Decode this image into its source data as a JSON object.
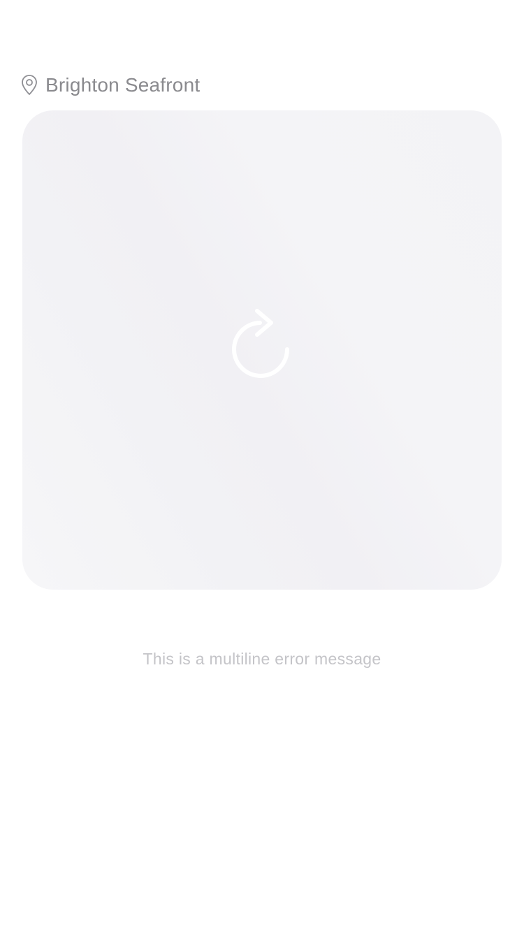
{
  "location": {
    "icon": "map-pin-icon",
    "name": "Brighton Seafront"
  },
  "media": {
    "state": "error",
    "reload_icon": "reload-icon",
    "colors": {
      "card_background": "#f3f3f6",
      "icon_color": "#ffffff"
    }
  },
  "error": {
    "message": "This is a multiline error message"
  },
  "colors": {
    "location_text": "#8a8a8e",
    "error_text": "#c4c4c8"
  }
}
